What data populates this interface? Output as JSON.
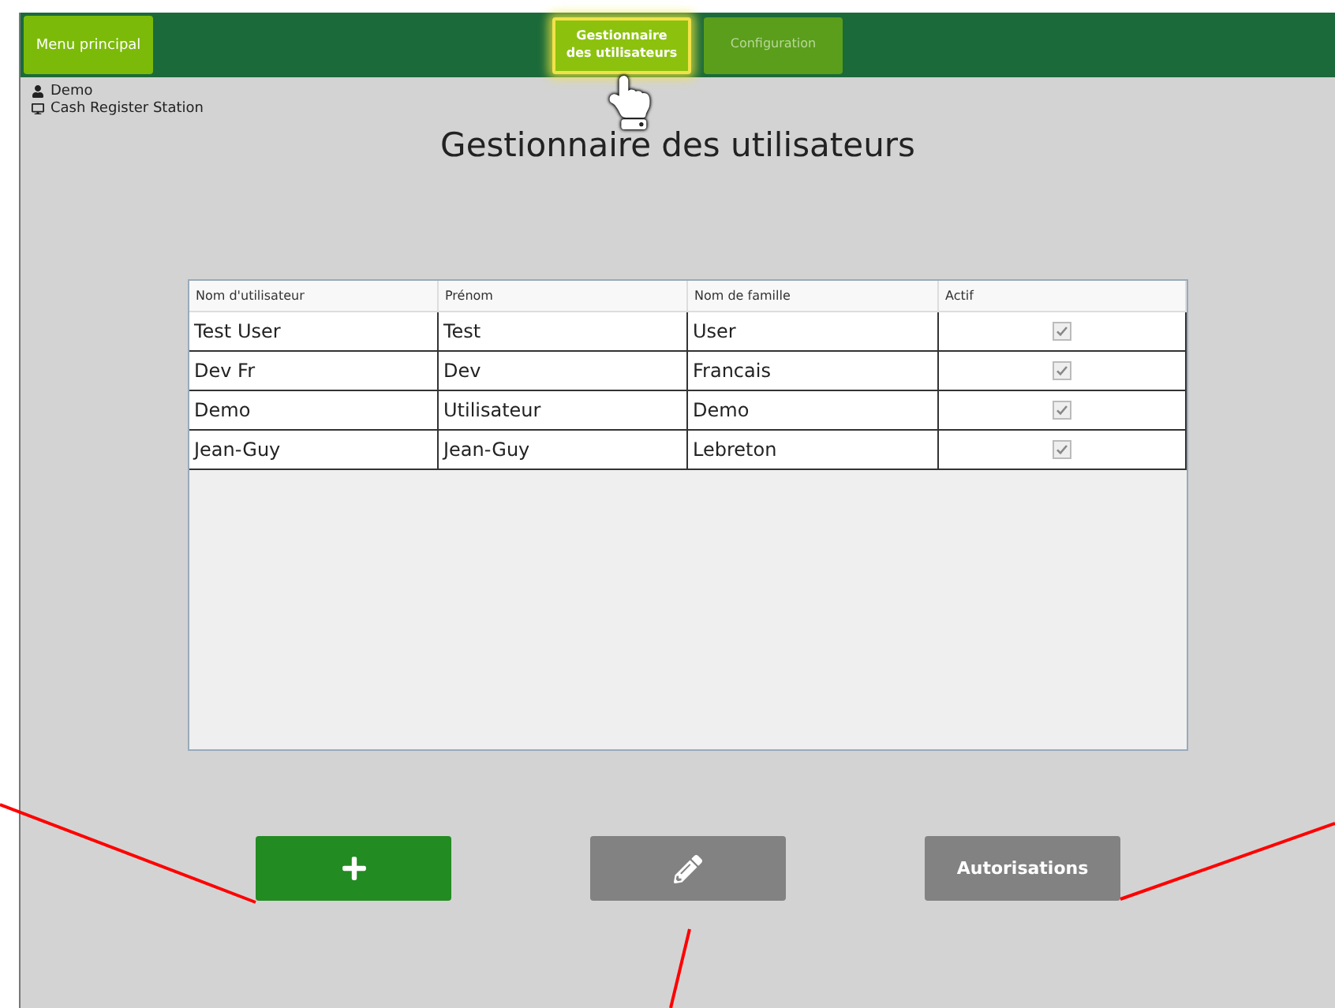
{
  "header": {
    "menu_button": "Menu principal",
    "tabs": [
      {
        "label": "Gestionnaire\ndes utilisateurs",
        "selected": true
      },
      {
        "label": "Configuration",
        "selected": false
      }
    ]
  },
  "session": {
    "user": "Demo",
    "station": "Cash Register Station"
  },
  "title": "Gestionnaire des utilisateurs",
  "table": {
    "columns": [
      "Nom d'utilisateur",
      "Prénom",
      "Nom de famille",
      "Actif"
    ],
    "rows": [
      {
        "cells": [
          "Test User",
          "Test",
          "User"
        ],
        "active": true
      },
      {
        "cells": [
          "Dev Fr",
          "Dev",
          "Francais"
        ],
        "active": true
      },
      {
        "cells": [
          "Demo",
          "Utilisateur",
          "Demo"
        ],
        "active": true
      },
      {
        "cells": [
          "Jean-Guy",
          "Jean-Guy",
          "Lebreton"
        ],
        "active": true
      }
    ]
  },
  "buttons": [
    {
      "kind": "add"
    },
    {
      "kind": "edit"
    },
    {
      "kind": "text",
      "label": "Autorisations"
    }
  ]
}
